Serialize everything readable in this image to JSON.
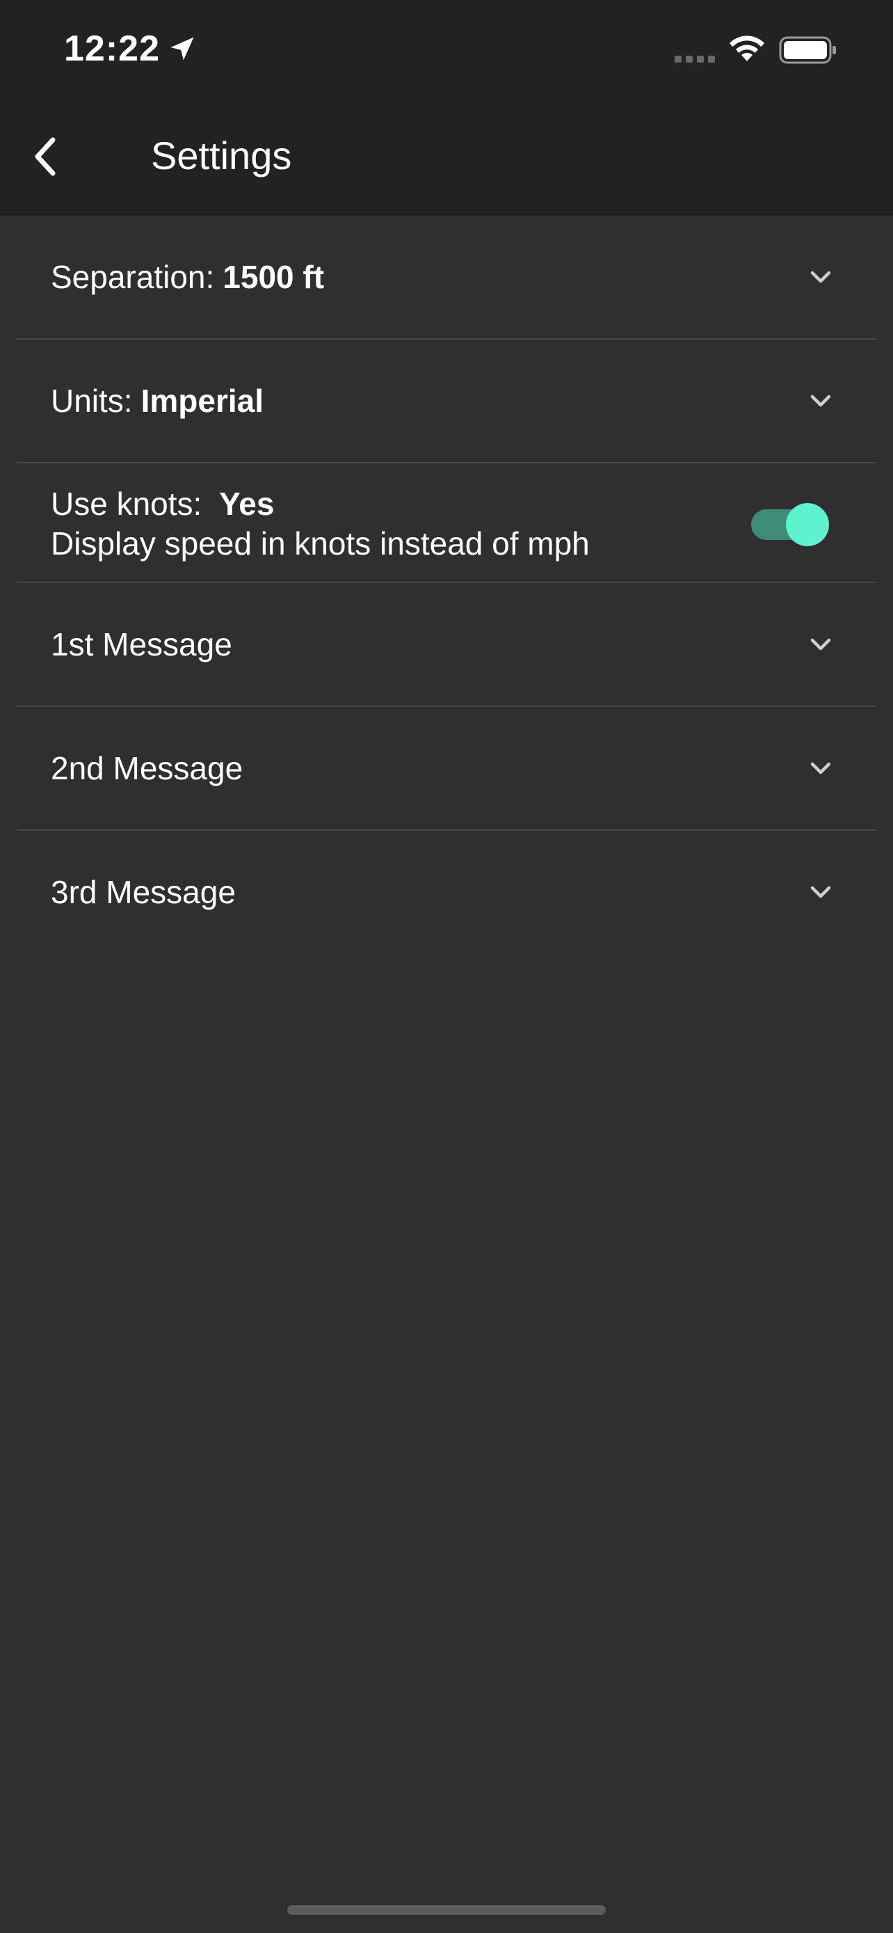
{
  "status_bar": {
    "time": "12:22",
    "location_icon": "location-arrow-icon",
    "signal_icon": "signal-dots-icon",
    "wifi_icon": "wifi-icon",
    "battery_icon": "battery-icon"
  },
  "header": {
    "back_icon": "chevron-left-icon",
    "title": "Settings"
  },
  "settings": {
    "separation": {
      "label": "Separation:",
      "value": "1500 ft"
    },
    "units": {
      "label": "Units:",
      "value": "Imperial"
    },
    "knots": {
      "label": "Use knots:",
      "value": "Yes",
      "description": "Display speed in knots instead of mph",
      "enabled": true
    },
    "message1": {
      "label": "1st Message"
    },
    "message2": {
      "label": "2nd Message"
    },
    "message3": {
      "label": "3rd Message"
    }
  },
  "colors": {
    "background": "#2f2f2f",
    "header_background": "#222222",
    "divider": "#494949",
    "toggle_track": "#3e8b76",
    "toggle_thumb": "#5ff2cf"
  }
}
